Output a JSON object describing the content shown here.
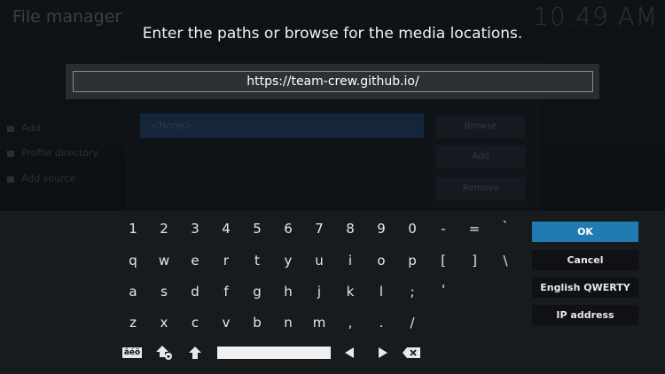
{
  "background": {
    "app_title": "File manager",
    "clock": "10:49 AM",
    "sidebar": [
      "Add",
      "Profile directory",
      "Add source"
    ],
    "path_placeholder": "<None>",
    "right_buttons": [
      "Browse",
      "Add",
      "Remove"
    ]
  },
  "prompt": "Enter the paths or browse for the media locations.",
  "input": {
    "value": "https://team-crew.github.io/"
  },
  "keyboard": {
    "rows": [
      [
        "1",
        "2",
        "3",
        "4",
        "5",
        "6",
        "7",
        "8",
        "9",
        "0",
        "-",
        "=",
        "`"
      ],
      [
        "q",
        "w",
        "e",
        "r",
        "t",
        "y",
        "u",
        "i",
        "o",
        "p",
        "[",
        "]",
        "\\"
      ],
      [
        "a",
        "s",
        "d",
        "f",
        "g",
        "h",
        "j",
        "k",
        "l",
        ";",
        "'"
      ],
      [
        "z",
        "x",
        "c",
        "v",
        "b",
        "n",
        "m",
        ",",
        ".",
        "/"
      ]
    ],
    "special": {
      "accents": "âéö",
      "icons": [
        "shift-lock-icon",
        "shift-icon",
        "space-bar",
        "arrow-left-icon",
        "arrow-right-icon",
        "backspace-icon"
      ]
    }
  },
  "side_buttons": {
    "ok": "OK",
    "cancel": "Cancel",
    "layout": "English QWERTY",
    "ip": "IP address"
  },
  "colors": {
    "accent": "#1f7bb0",
    "panel": "#181b1e"
  }
}
